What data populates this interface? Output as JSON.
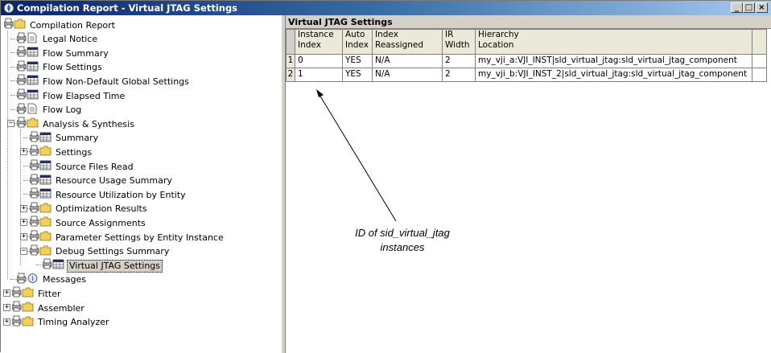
{
  "window": {
    "title": "Compilation Report - Virtual JTAG Settings",
    "controls": {
      "minimize": "_",
      "maximize": "□",
      "close": "×"
    }
  },
  "tree": {
    "items": [
      {
        "label": "Compilation Report",
        "icon": "folder-open-icon"
      },
      {
        "label": "Legal Notice",
        "icon": "document-icon"
      },
      {
        "label": "Flow Summary",
        "icon": "table-icon"
      },
      {
        "label": "Flow Settings",
        "icon": "table-icon"
      },
      {
        "label": "Flow Non-Default Global Settings",
        "icon": "table-icon"
      },
      {
        "label": "Flow Elapsed Time",
        "icon": "table-icon"
      },
      {
        "label": "Flow Log",
        "icon": "document-icon"
      },
      {
        "label": "Analysis & Synthesis",
        "icon": "folder-open-icon"
      },
      {
        "label": "Summary",
        "icon": "table-icon"
      },
      {
        "label": "Settings",
        "icon": "folder-icon"
      },
      {
        "label": "Source Files Read",
        "icon": "table-icon"
      },
      {
        "label": "Resource Usage Summary",
        "icon": "table-icon"
      },
      {
        "label": "Resource Utilization by Entity",
        "icon": "table-icon"
      },
      {
        "label": "Optimization Results",
        "icon": "folder-icon"
      },
      {
        "label": "Source Assignments",
        "icon": "folder-icon"
      },
      {
        "label": "Parameter Settings by Entity Instance",
        "icon": "folder-icon"
      },
      {
        "label": "Debug Settings Summary",
        "icon": "folder-open-icon"
      },
      {
        "label": "Virtual JTAG Settings",
        "icon": "table-icon",
        "selected": true
      },
      {
        "label": "Messages",
        "icon": "messages-icon"
      },
      {
        "label": "Fitter",
        "icon": "folder-icon"
      },
      {
        "label": "Assembler",
        "icon": "folder-icon"
      },
      {
        "label": "Timing Analyzer",
        "icon": "folder-icon"
      }
    ]
  },
  "report": {
    "title": "Virtual JTAG Settings",
    "columns": [
      {
        "line1": "Instance",
        "line2": "Index"
      },
      {
        "line1": "Auto",
        "line2": "Index"
      },
      {
        "line1": "Index",
        "line2": "Reassigned"
      },
      {
        "line1": "IR",
        "line2": "Width"
      },
      {
        "line1": "Hierarchy",
        "line2": "Location"
      }
    ],
    "rows": [
      {
        "num": "1",
        "instance_index": "0",
        "auto_index": "YES",
        "index_reassigned": "N/A",
        "ir_width": "2",
        "hierarchy": "my_vji_a:VJI_INST|sld_virtual_jtag:sld_virtual_jtag_component"
      },
      {
        "num": "2",
        "instance_index": "1",
        "auto_index": "YES",
        "index_reassigned": "N/A",
        "ir_width": "2",
        "hierarchy": "my_vji_b:VJI_INST_2|sld_virtual_jtag:sld_virtual_jtag_component"
      }
    ]
  },
  "annotation": {
    "line1": "ID of sid_virtual_jtag",
    "line2": "instances"
  },
  "colors": {
    "titlebar_start": "#0a246a",
    "titlebar_end": "#a6caf0",
    "chrome": "#d4d0c8"
  }
}
